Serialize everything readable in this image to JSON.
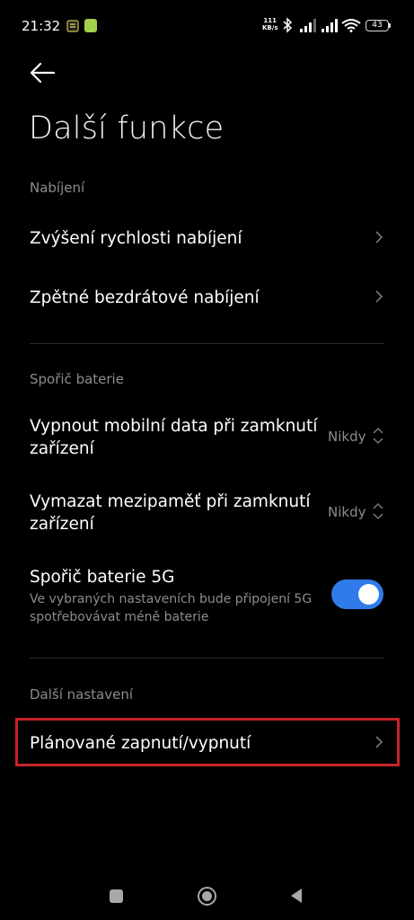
{
  "status_bar": {
    "time": "21:32",
    "net_speed_value": "111",
    "net_speed_unit": "KB/s",
    "battery": "43"
  },
  "header": {
    "title": "Další funkce"
  },
  "sections": {
    "charging": {
      "header": "Nabíjení",
      "item1": "Zvýšení rychlosti nabíjení",
      "item2": "Zpětné bezdrátové nabíjení"
    },
    "battery_saver": {
      "header": "Spořič baterie",
      "item1_line1": "Vypnout mobilní data při zamknutí",
      "item1_line2": "zařízení",
      "item1_value": "Nikdy",
      "item2_line1": "Vymazat mezipaměť při zamknutí",
      "item2_line2": "zařízení",
      "item2_value": "Nikdy",
      "item3_title": "Spořič baterie 5G",
      "item3_sub_line1": "Ve vybraných nastaveních bude připojení 5G",
      "item3_sub_line2": "spotřebovávat méně baterie",
      "item3_toggle_on": true
    },
    "more": {
      "header": "Další nastavení",
      "item1": "Plánované zapnutí/vypnutí"
    }
  },
  "colors": {
    "background": "#000000",
    "accent": "#2f7bea",
    "highlight": "#c8232a",
    "secondary_text": "#8c8c8c"
  },
  "icons": {
    "back": "arrow-left-icon",
    "chevron": "chevron-right-icon",
    "updown": "chevron-up-down-icon"
  }
}
